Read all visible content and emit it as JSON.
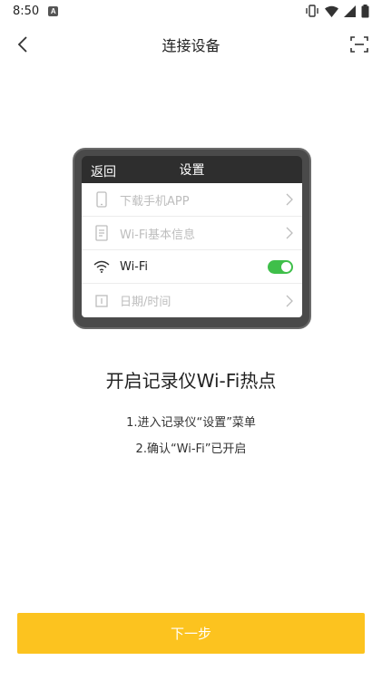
{
  "status_bar": {
    "time": "8:50",
    "app_icon_letter": "A"
  },
  "nav": {
    "title": "连接设备"
  },
  "device": {
    "header_back": "返回",
    "header_title": "设置",
    "rows": [
      {
        "label": "下载手机APP",
        "icon": "phone-icon",
        "state": "disabled"
      },
      {
        "label": "Wi-Fi基本信息",
        "icon": "info-doc-icon",
        "state": "disabled"
      },
      {
        "label": "Wi-Fi",
        "icon": "wifi-icon",
        "state": "active",
        "toggle_on": true
      },
      {
        "label": "日期/时间",
        "icon": "calendar-icon",
        "state": "disabled"
      }
    ]
  },
  "instructions": {
    "heading": "开启记录仪Wi-Fi热点",
    "step1": "1.进入记录仪“设置”菜单",
    "step2": "2.确认“Wi-Fi”已开启"
  },
  "next_button": {
    "label": "下一步"
  },
  "colors": {
    "accent": "#fcc31f",
    "toggle_on": "#3fbf4a"
  }
}
